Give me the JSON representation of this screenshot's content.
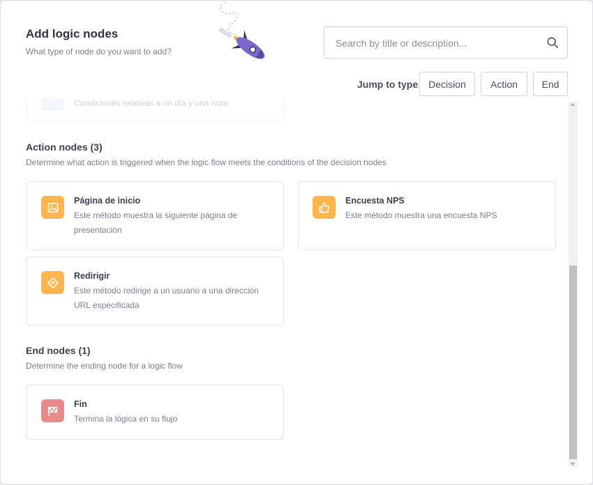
{
  "header": {
    "title": "Add logic nodes",
    "subtitle": "What type of node do you want to add?"
  },
  "search": {
    "placeholder": "Search by title or description..."
  },
  "jump": {
    "label": "Jump to type",
    "buttons": [
      "Decision",
      "Action",
      "End"
    ]
  },
  "colors": {
    "action_icon": "#ffb54d",
    "end_icon": "#e88a8a",
    "decision_icon": "#dce6fb"
  },
  "decision_partial": {
    "description": "Condiciones relativas a un día y una hora",
    "icon": "calendar-icon"
  },
  "action_section": {
    "title": "Action nodes (3)",
    "description": "Determine what action is triggered when the logic flow meets the conditions of the decision nodes",
    "items": [
      {
        "title": "Página de inicio",
        "description": "Este método muestra la siguiente página de presentación",
        "icon": "image-icon"
      },
      {
        "title": "Encuesta NPS",
        "description": "Este método muestra una encuesta NPS",
        "icon": "thumbs-up-icon"
      },
      {
        "title": "Redirigir",
        "description": "Este método redirige a un usuario a una dirección URL especificada",
        "icon": "redirect-icon"
      }
    ]
  },
  "end_section": {
    "title": "End nodes (1)",
    "description": "Determine the ending node for a logic flow",
    "items": [
      {
        "title": "Fin",
        "description": "Termina la lógica en su flujo",
        "icon": "checkered-flag-icon"
      }
    ]
  }
}
